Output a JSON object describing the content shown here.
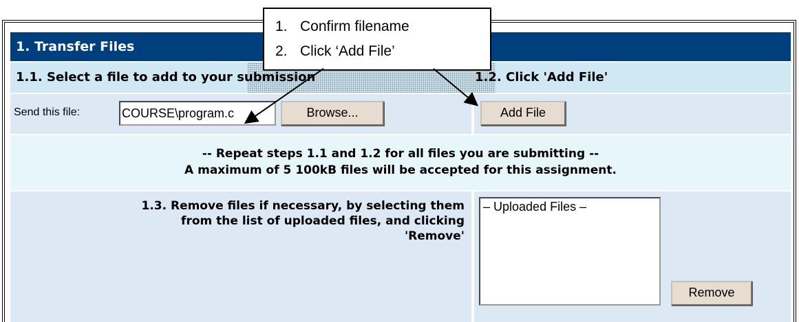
{
  "section": {
    "title": "1. Transfer Files",
    "step_1_1": "1.1. Select a file to add to your submission",
    "step_1_2": "1.2. Click 'Add File'"
  },
  "file_row": {
    "send_label": "Send this file:",
    "file_value": "COURSE\\program.c",
    "browse_label": "Browse...",
    "add_file_label": "Add File"
  },
  "info": {
    "line1": "-- Repeat steps 1.1 and 1.2 for all files you are submitting --",
    "line2": "A maximum of 5 100kB files will be accepted for this assignment."
  },
  "remove_section": {
    "instruction_line1": "1.3. Remove files if necessary, by selecting them",
    "instruction_line2": "from the list of uploaded files, and clicking",
    "instruction_line3": "'Remove'",
    "list_header": "– Uploaded Files –",
    "remove_label": "Remove"
  },
  "callout": {
    "num1": "1.",
    "text1": "Confirm filename",
    "num2": "2.",
    "text2": "Click ‘Add File’"
  },
  "colors": {
    "title_bar": "#003f7e",
    "subheader": "#cfe8f4",
    "row": "#dde8f5",
    "info_row": "#e6f6fb",
    "button": "#e7dcd0"
  }
}
